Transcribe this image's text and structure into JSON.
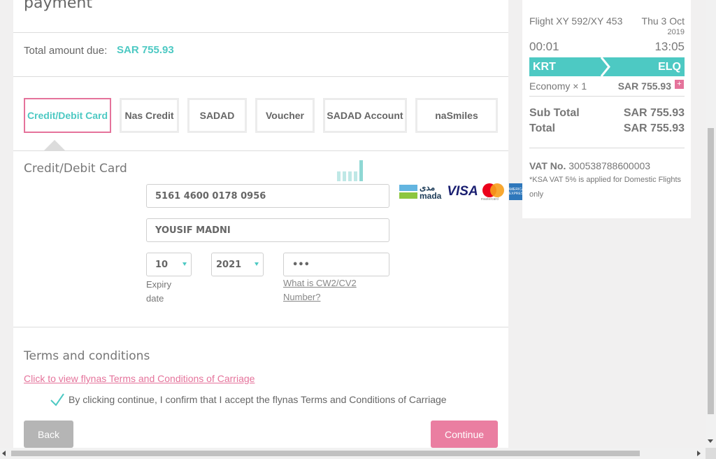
{
  "main": {
    "heading": "payment",
    "total_label": "Total amount due:",
    "total_amount": "SAR 755.93",
    "tabs": [
      {
        "label": "Credit/Debit Card",
        "active": true
      },
      {
        "label": "Nas Credit"
      },
      {
        "label": "SADAD"
      },
      {
        "label": "Voucher"
      },
      {
        "label": "SADAD Account"
      },
      {
        "label": "naSmiles"
      }
    ],
    "card_section_title": "Credit/Debit Card",
    "card_number": "5161 4600 0178 0956",
    "card_holder": "YOUSIF MADNI",
    "expiry_month": "10",
    "expiry_year": "2021",
    "expiry_label_1": "Expiry",
    "expiry_label_2": "date",
    "cvv": "•••",
    "cvv_link_1": "What is CW2/CV2",
    "cvv_link_2": "Number?",
    "logos": {
      "mada_arabic": "مدى",
      "mada": "mada",
      "visa": "VISA",
      "mastercard": "mastercard",
      "amex": "AMERICAN EXPRESS"
    },
    "terms_title": "Terms and conditions",
    "terms_link": "Click to view flynas Terms and Conditions of Carriage",
    "terms_confirm": "By clicking continue, I confirm that I accept the flynas Terms and Conditions of Carriage",
    "back_label": "Back",
    "continue_label": "Continue"
  },
  "sidebar": {
    "flight": "Flight XY 592/XY 453",
    "date": "Thu 3 Oct",
    "year": "2019",
    "depart_time": "00:01",
    "arrive_time": "13:05",
    "origin": "KRT",
    "destination": "ELQ",
    "fare_class": "Economy × 1",
    "fare_amount": "SAR 755.93",
    "plus": "+",
    "subtotal_label": "Sub Total",
    "subtotal_value": "SAR 755.93",
    "total_label": "Total",
    "total_value": "SAR 755.93",
    "vat_label": "VAT No.",
    "vat_number": "300538788600003",
    "vat_note_1": "*KSA VAT 5% is applied for Domestic Flights",
    "vat_note_2": "only"
  },
  "colors": {
    "accent_teal": "#4dc9c3",
    "accent_pink": "#e5739b",
    "button_grey": "#b5b5b5"
  }
}
